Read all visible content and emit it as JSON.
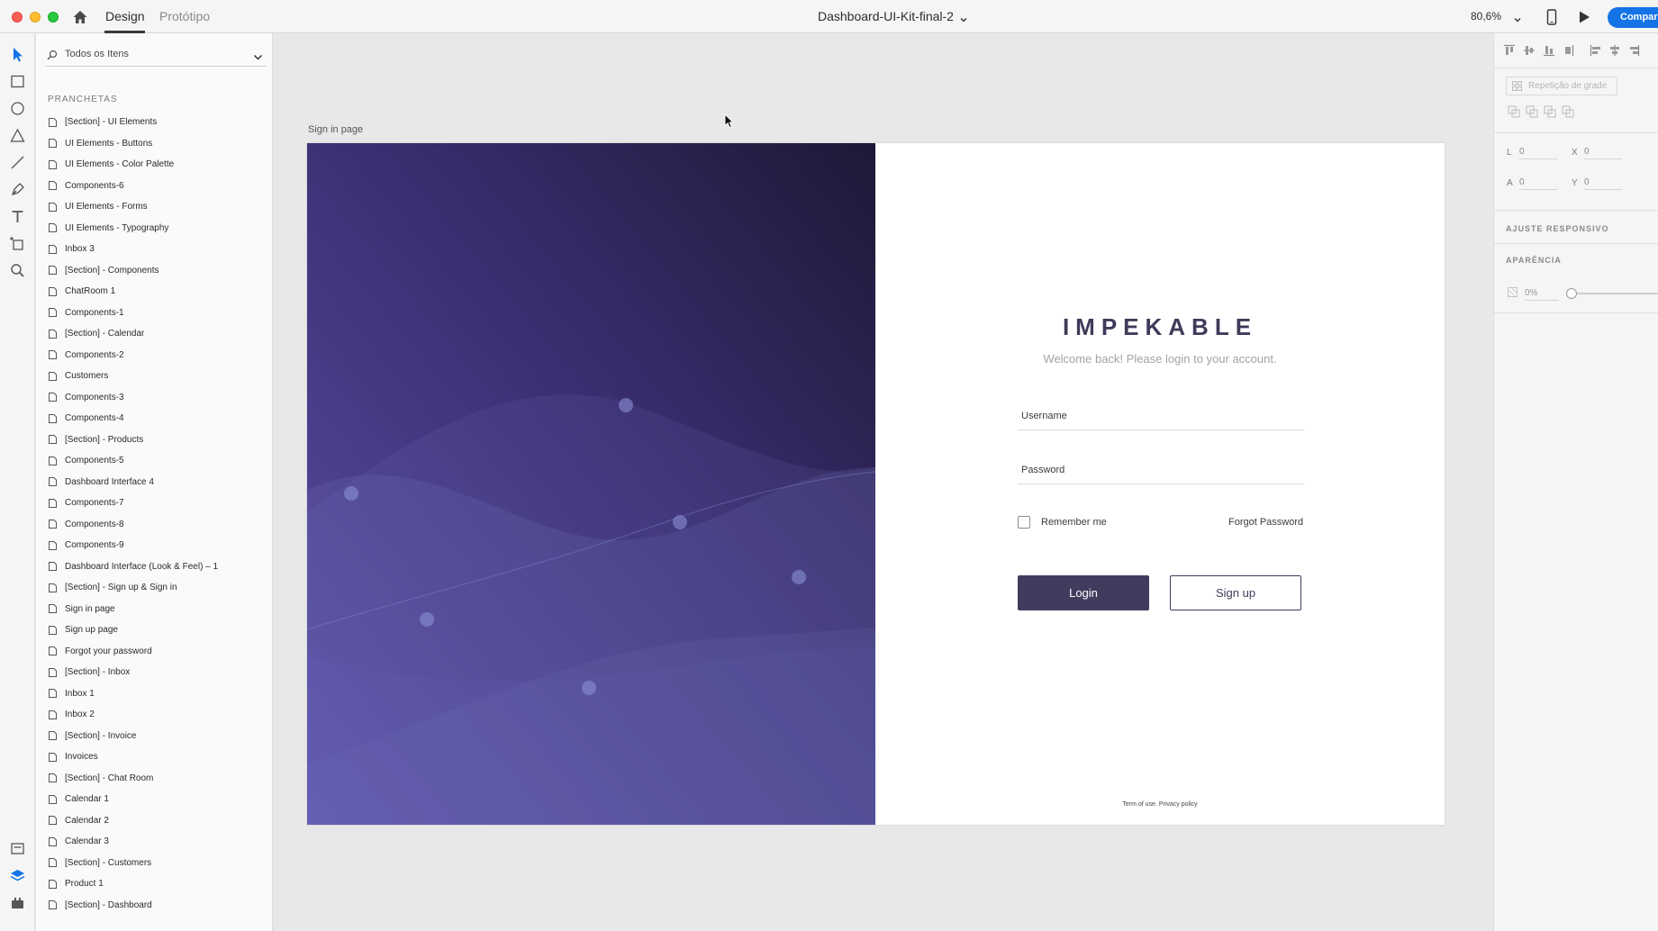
{
  "titlebar": {
    "tabs": {
      "design": "Design",
      "prototype": "Protótipo"
    },
    "document_title": "Dashboard-UI-Kit-final-2",
    "zoom": "80,6%",
    "share_label": "Compartilhar"
  },
  "layers": {
    "search_placeholder": "Todos os Itens",
    "section_title": "PRANCHETAS",
    "items": [
      "[Section] - UI Elements",
      "UI Elements - Buttons",
      "UI Elements - Color Palette",
      "Components-6",
      "UI Elements - Forms",
      "UI Elements - Typography",
      "Inbox 3",
      "[Section] - Components",
      "ChatRoom 1",
      "Components-1",
      "[Section] - Calendar",
      "Components-2",
      "Customers",
      "Components-3",
      "Components-4",
      "[Section] - Products",
      "Components-5",
      "Dashboard Interface 4",
      "Components-7",
      "Components-8",
      "Components-9",
      "Dashboard Interface (Look & Feel) – 1",
      "[Section] - Sign up & Sign in",
      "Sign in page",
      "Sign up page",
      "Forgot your password",
      "[Section] - Inbox",
      "Inbox 1",
      "Inbox 2",
      "[Section] - Invoice",
      "Invoices",
      "[Section] - Chat Room",
      "Calendar 1",
      "Calendar 2",
      "Calendar 3",
      "[Section] - Customers",
      "Product 1",
      "[Section] - Dashboard"
    ]
  },
  "artboard": {
    "label": "Sign in page",
    "brand": "IMPEKABLE",
    "welcome": "Welcome back! Please login to your account.",
    "username_placeholder": "Username",
    "password_placeholder": "Password",
    "remember_label": "Remember me",
    "forgot_label": "Forgot Password",
    "login_label": "Login",
    "signup_label": "Sign up",
    "terms_label": "Term of use.",
    "privacy_label": "Privacy policy",
    "colors": {
      "gradient_top": "#231c3f",
      "gradient_bottom": "#5c4ea8",
      "brand_text": "#413a5a",
      "button_primary": "#433b5e"
    }
  },
  "properties": {
    "grid_repeat": "Repetição de grade",
    "labels": {
      "w": "L",
      "h": "A",
      "x": "X",
      "y": "Y"
    },
    "values": {
      "w": "0",
      "h": "0",
      "x": "0",
      "y": "0"
    },
    "responsive_heading": "AJUSTE RESPONSIVO",
    "appearance_heading": "APARÊNCIA",
    "opacity": "0%"
  },
  "colors": {
    "accent": "#1473e6"
  }
}
